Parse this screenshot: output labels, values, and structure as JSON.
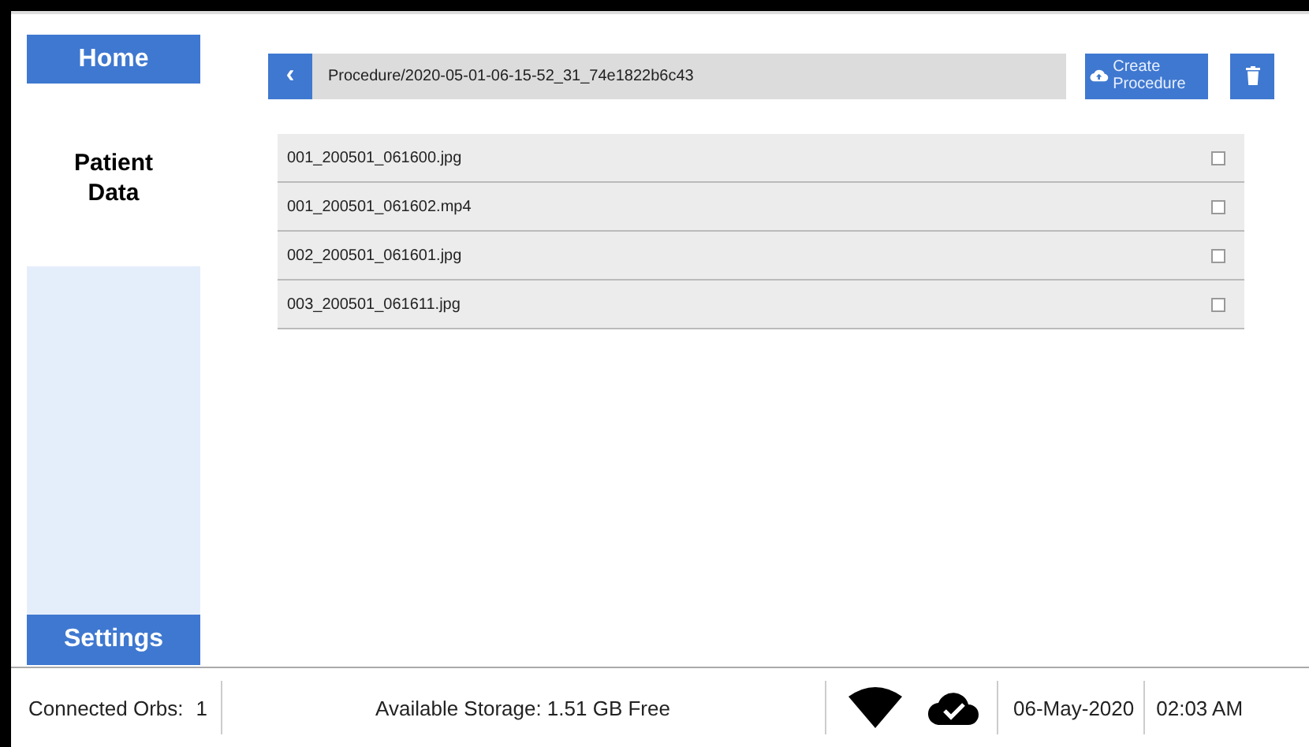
{
  "sidebar": {
    "items": [
      {
        "label": "Home",
        "kind": "button"
      },
      {
        "label": "Patient Data",
        "kind": "heading"
      },
      {
        "kind": "panel"
      }
    ],
    "bottom": {
      "label": "Settings"
    }
  },
  "toolbar": {
    "back": "‹",
    "path": "Procedure/2020-05-01-06-15-52_31_74e1822b6c43",
    "create": "Create Procedure"
  },
  "files": [
    {
      "name": "001_200501_061600.jpg",
      "checked": false
    },
    {
      "name": "001_200501_061602.mp4",
      "checked": false
    },
    {
      "name": "002_200501_061601.jpg",
      "checked": false
    },
    {
      "name": "003_200501_061611.jpg",
      "checked": false
    }
  ],
  "status_bar": {
    "orbs_label": "Connected Orbs:",
    "orbs": "1",
    "storage": "Available Storage: 1.51 GB Free",
    "date": "06-May-2020",
    "time": "02:03 AM"
  }
}
